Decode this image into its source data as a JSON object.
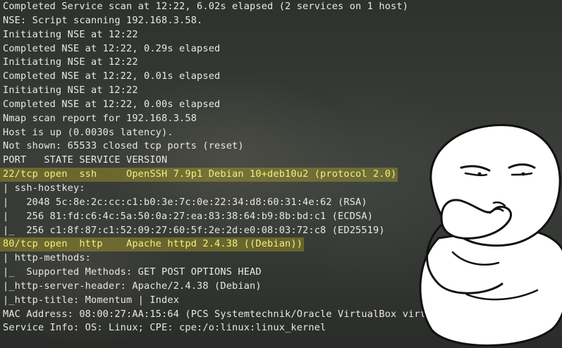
{
  "terminal": {
    "lines": [
      {
        "text": "Completed Service scan at 12:22, 6.02s elapsed (2 services on 1 host)",
        "highlight": false
      },
      {
        "text": "NSE: Script scanning 192.168.3.58.",
        "highlight": false
      },
      {
        "text": "Initiating NSE at 12:22",
        "highlight": false
      },
      {
        "text": "Completed NSE at 12:22, 0.29s elapsed",
        "highlight": false
      },
      {
        "text": "Initiating NSE at 12:22",
        "highlight": false
      },
      {
        "text": "Completed NSE at 12:22, 0.01s elapsed",
        "highlight": false
      },
      {
        "text": "Initiating NSE at 12:22",
        "highlight": false
      },
      {
        "text": "Completed NSE at 12:22, 0.00s elapsed",
        "highlight": false
      },
      {
        "text": "Nmap scan report for 192.168.3.58",
        "highlight": false
      },
      {
        "text": "Host is up (0.0030s latency).",
        "highlight": false
      },
      {
        "text": "Not shown: 65533 closed tcp ports (reset)",
        "highlight": false
      },
      {
        "text": "PORT   STATE SERVICE VERSION",
        "highlight": false
      },
      {
        "text": "22/tcp open  ssh     OpenSSH 7.9p1 Debian 10+deb10u2 (protocol 2.0)",
        "highlight": true
      },
      {
        "text": "| ssh-hostkey: ",
        "highlight": false
      },
      {
        "text": "|   2048 5c:8e:2c:cc:c1:b0:3e:7c:0e:22:34:d8:60:31:4e:62 (RSA)",
        "highlight": false
      },
      {
        "text": "|   256 81:fd:c6:4c:5a:50:0a:27:ea:83:38:64:b9:8b:bd:c1 (ECDSA)",
        "highlight": false
      },
      {
        "text": "|_  256 c1:8f:87:c1:52:09:27:60:5f:2e:2d:e0:08:03:72:c8 (ED25519)",
        "highlight": false
      },
      {
        "text": "80/tcp open  http    Apache httpd 2.4.38 ((Debian))",
        "highlight": true
      },
      {
        "text": "| http-methods: ",
        "highlight": false
      },
      {
        "text": "|_  Supported Methods: GET POST OPTIONS HEAD",
        "highlight": false
      },
      {
        "text": "|_http-server-header: Apache/2.4.38 (Debian)",
        "highlight": false
      },
      {
        "text": "|_http-title: Momentum | Index",
        "highlight": false
      },
      {
        "text": "MAC Address: 08:00:27:AA:15:64 (PCS Systemtechnik/Oracle VirtualBox virtual NIC)",
        "highlight": false
      },
      {
        "text": "Service Info: OS: Linux; CPE: cpe:/o:linux:linux_kernel",
        "highlight": false
      }
    ],
    "colors": {
      "text": "#e8e8e8",
      "highlight_text": "#f2ef80",
      "highlight_bg": "rgba(235, 220, 30, 0.28)"
    }
  },
  "overlay": {
    "icon": "thinking-meme-character"
  }
}
